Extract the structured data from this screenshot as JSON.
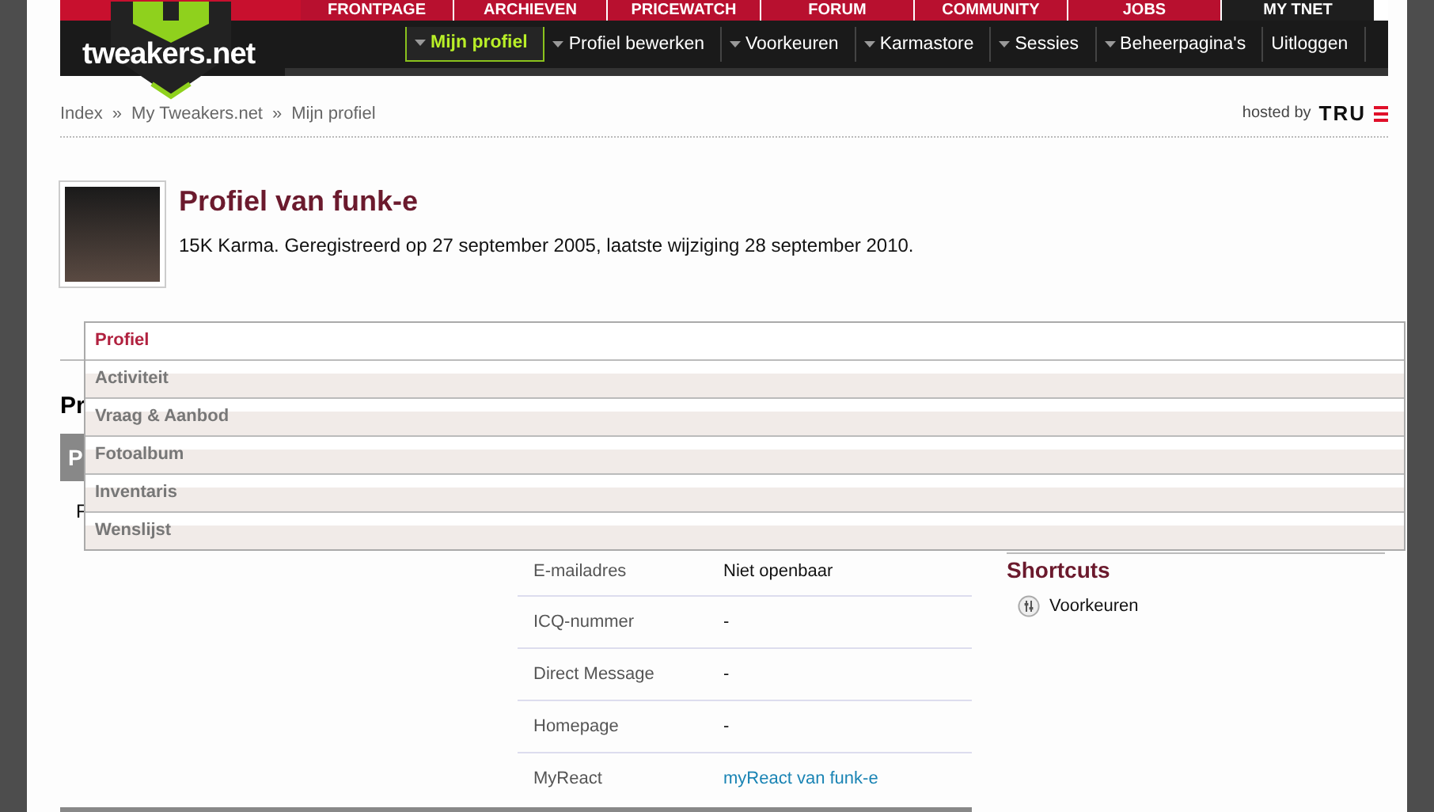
{
  "top_nav": [
    {
      "label": "FRONTPAGE",
      "selected": false
    },
    {
      "label": "ARCHIEVEN",
      "selected": false
    },
    {
      "label": "PRICEWATCH",
      "selected": false
    },
    {
      "label": "FORUM",
      "selected": false
    },
    {
      "label": "COMMUNITY",
      "selected": false
    },
    {
      "label": "JOBS",
      "selected": false
    },
    {
      "label": "MY TNET",
      "selected": true
    }
  ],
  "logo": "tweakers.net",
  "sub_nav": [
    {
      "label": "Mijn profiel",
      "selected": true,
      "has_menu": true
    },
    {
      "label": "Profiel bewerken",
      "selected": false,
      "has_menu": true
    },
    {
      "label": "Voorkeuren",
      "selected": false,
      "has_menu": true
    },
    {
      "label": "Karmastore",
      "selected": false,
      "has_menu": true
    },
    {
      "label": "Sessies",
      "selected": false,
      "has_menu": true
    },
    {
      "label": "Beheerpagina's",
      "selected": false,
      "has_menu": true
    },
    {
      "label": "Uitloggen",
      "selected": false,
      "has_menu": false
    }
  ],
  "breadcrumb": {
    "separator": "»",
    "items": [
      "Index",
      "My Tweakers.net",
      "Mijn profiel"
    ]
  },
  "hosted_by": {
    "label": "hosted by",
    "brand": "TRU"
  },
  "profile": {
    "title": "Profiel van funk-e",
    "summary": "15K Karma. Geregistreerd op 27 september 2005, laatste wijziging 28 september 2010."
  },
  "dropdown": [
    {
      "label": "Profiel",
      "selected": true
    },
    {
      "label": "Activiteit",
      "selected": false
    },
    {
      "label": "Vraag & Aanbod",
      "selected": false
    },
    {
      "label": "Fotoalbum",
      "selected": false
    },
    {
      "label": "Inventaris",
      "selected": false
    },
    {
      "label": "Wenslijst",
      "selected": false
    }
  ],
  "section_heading": "Pr",
  "section_bar": "P",
  "left_text": "F",
  "details": [
    {
      "label": "E-mailadres",
      "value": "Niet openbaar",
      "kind": "text"
    },
    {
      "label": "ICQ-nummer",
      "value": "-",
      "kind": "text"
    },
    {
      "label": "Direct Message",
      "value": "-",
      "kind": "text"
    },
    {
      "label": "Homepage",
      "value": "-",
      "kind": "text"
    },
    {
      "label": "MyReact",
      "value": "myReact van funk-e",
      "kind": "link"
    }
  ],
  "shortcuts": {
    "title": "Shortcuts",
    "items": [
      {
        "label": "Voorkeuren"
      }
    ]
  }
}
